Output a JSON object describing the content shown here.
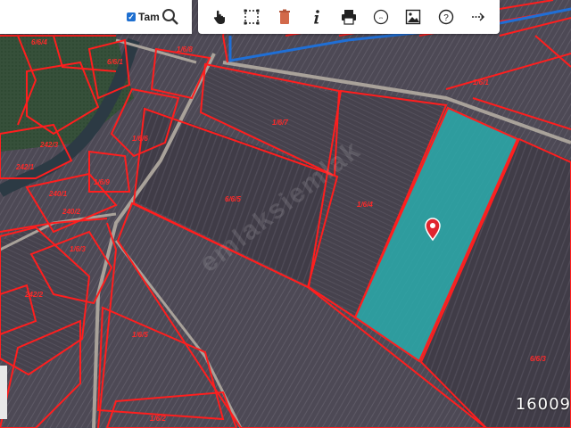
{
  "search_bar": {
    "checkbox_label": "Tam",
    "checkbox_checked": true,
    "search_icon": "search-icon"
  },
  "toolbar": {
    "items": [
      {
        "name": "hand-pointer-icon",
        "label": "pan"
      },
      {
        "name": "select-area-icon",
        "label": "select"
      },
      {
        "name": "trash-icon",
        "label": "delete"
      },
      {
        "name": "info-icon",
        "label": "info"
      },
      {
        "name": "print-icon",
        "label": "print"
      },
      {
        "name": "layers-circle-icon",
        "label": "layers"
      },
      {
        "name": "image-icon",
        "label": "image"
      },
      {
        "name": "help-icon",
        "label": "help"
      },
      {
        "name": "arrow-right-icon",
        "label": "next"
      }
    ]
  },
  "map": {
    "selected_parcel_color": "#2aa7a8",
    "boundary_color": "#ff1e1e",
    "road_color": "#1f6fd6",
    "watermark": "emlaksiemlak",
    "parcel_labels": [
      "1/6/7",
      "6/6/5",
      "1/6/4",
      "6/6/3",
      "242/2",
      "1/6/5",
      "1/6/2",
      "1/6/3",
      "1/6/6",
      "1/6/1",
      "6/6/4",
      "1/6/8",
      "242/3",
      "242/1",
      "240/1",
      "240/2",
      "1/6/9",
      "6/6/1"
    ],
    "coordinate_readout": "16009"
  }
}
